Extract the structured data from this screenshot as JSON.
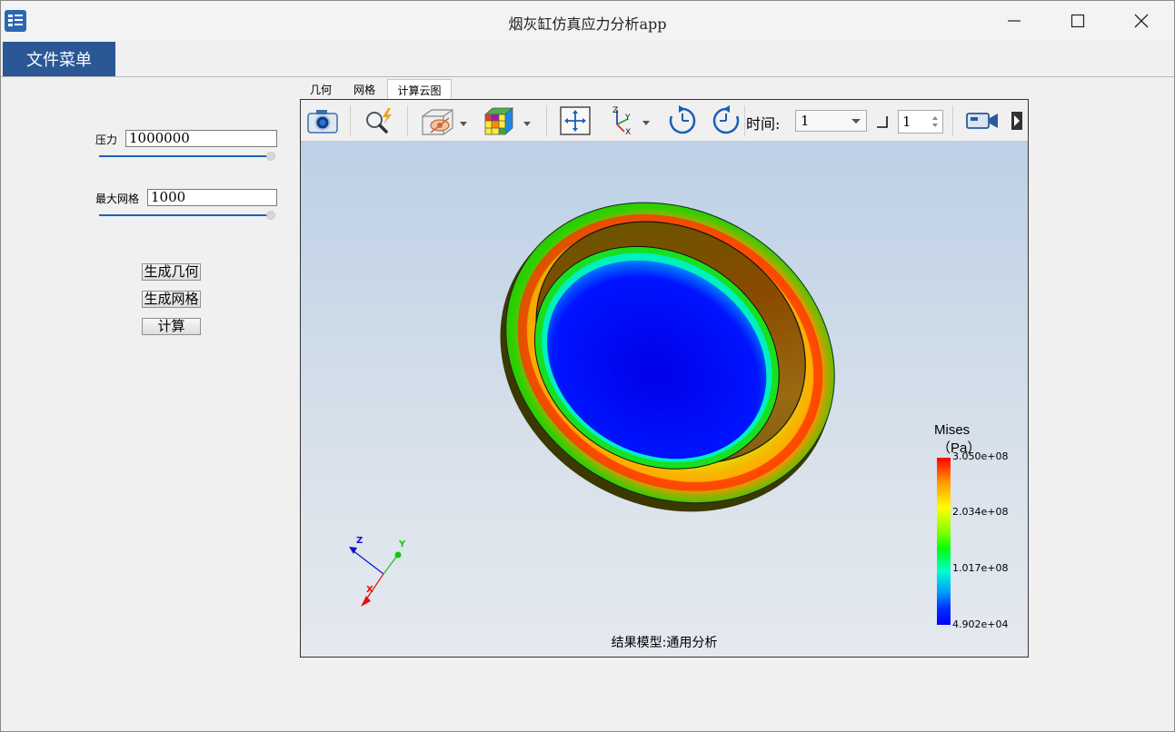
{
  "window": {
    "title": "烟灰缸仿真应力分析app"
  },
  "menu": {
    "file_label": "文件菜单"
  },
  "params": {
    "pressure_label": "压力",
    "pressure_value": "1000000",
    "pressure_slider_level": 1.0,
    "mesh_label": "最大网格",
    "mesh_value": "1000",
    "mesh_slider_level": 1.0
  },
  "actions": {
    "gen_geometry": "生成几何",
    "gen_mesh": "生成网格",
    "compute": "计算"
  },
  "tabs": [
    {
      "label": "几何",
      "active": false
    },
    {
      "label": "网格",
      "active": false
    },
    {
      "label": "计算云图",
      "active": true
    }
  ],
  "toolbar": {
    "time_label": "时间:",
    "time_value": "1",
    "step_value": "1",
    "icons": [
      "camera-icon",
      "zoom-icon",
      "visibility-icon",
      "color-cube-icon",
      "fit-view-icon",
      "axes-icon",
      "rotate-cw-icon",
      "rotate-ccw-icon",
      "video-icon"
    ]
  },
  "viewer": {
    "result_label": "结果模型:通用分析",
    "triad": {
      "z": "Z",
      "y": "Y",
      "x": "X"
    }
  },
  "legend": {
    "title": "Mises",
    "unit": "（Pa）",
    "ticks": [
      "3.050e+08",
      "2.034e+08",
      "1.017e+08",
      "4.902e+04"
    ],
    "colors": {
      "max": "#ff0000",
      "mid": "#00ff10",
      "min": "#0000ff"
    }
  }
}
